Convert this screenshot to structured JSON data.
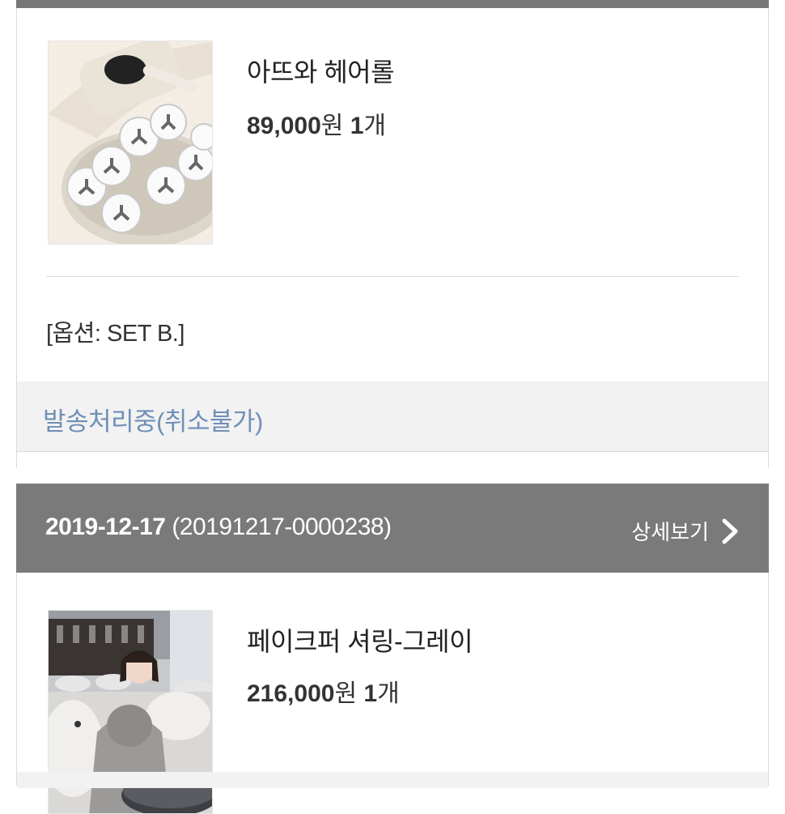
{
  "orders": [
    {
      "item": {
        "name": "아뜨와 헤어롤",
        "price": "89,000",
        "currency": "원",
        "qty": "1",
        "qty_unit": "개",
        "image": "hair-roller-kit-photo"
      },
      "option": "[옵션: SET B.]",
      "status": "발송처리중(취소불가)"
    },
    {
      "date": "2019-12-17",
      "order_number": "(20191217-0000238)",
      "detail_label": "상세보기",
      "detail_icon": "chevron-right-icon",
      "item": {
        "name": "페이크퍼 셔링-그레이",
        "price": "216,000",
        "currency": "원",
        "qty": "1",
        "qty_unit": "개",
        "image": "fur-coat-model-photo"
      }
    }
  ],
  "colors": {
    "header_bg": "#7a7a7a",
    "status_text": "#6f8fb7",
    "status_bg": "#f2f2f2"
  }
}
